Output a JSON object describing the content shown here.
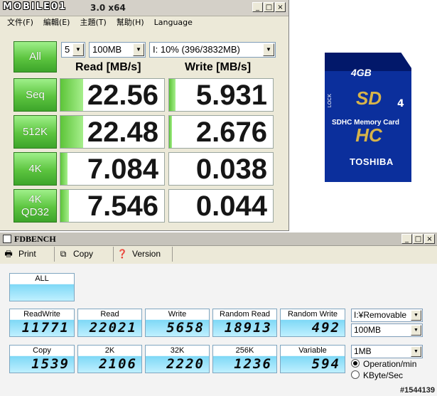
{
  "crystaldiskmark": {
    "title_logo": "MOBILE01",
    "title_version": "3.0 x64",
    "window_controls": [
      "_",
      "□",
      "×"
    ],
    "menu": [
      "文件(F)",
      "編輯(E)",
      "主題(T)",
      "幫助(H)",
      "Language"
    ],
    "all_label": "All",
    "runs": "5",
    "size": "100MB",
    "drive": "I: 10% (396/3832MB)",
    "read_header": "Read [MB/s]",
    "write_header": "Write [MB/s]",
    "rows": [
      {
        "label": "Seq",
        "read": "22.56",
        "write": "5.931",
        "read_fill": 0.22,
        "write_fill": 0.06
      },
      {
        "label": "512K",
        "read": "22.48",
        "write": "2.676",
        "read_fill": 0.22,
        "write_fill": 0.03
      },
      {
        "label": "4K",
        "read": "7.084",
        "write": "0.038",
        "read_fill": 0.07,
        "write_fill": 0.0
      },
      {
        "label_line1": "4K",
        "label_line2": "QD32",
        "read": "7.546",
        "write": "0.044",
        "read_fill": 0.08,
        "write_fill": 0.0
      }
    ],
    "accent_green": "#5cc43f"
  },
  "sd_card": {
    "capacity": "4GB",
    "logo": "SD HC",
    "class": "4",
    "lock": "LOCK",
    "subtitle": "SDHC Memory Card",
    "brand": "TOSHIBA",
    "color": "#0b2f9c"
  },
  "fdbench": {
    "title": "FDBENCH",
    "window_controls": [
      "_",
      "□",
      "×"
    ],
    "toolbar": {
      "print_label": "Print",
      "copy_label": "Copy",
      "version_label": "Version"
    },
    "all_label": "ALL",
    "row1": [
      {
        "label": "ReadWrite",
        "value": "11771"
      },
      {
        "label": "Read",
        "value": "22021"
      },
      {
        "label": "Write",
        "value": "5658"
      },
      {
        "label": "Random Read",
        "value": "18913"
      },
      {
        "label": "Random Write",
        "value": "492"
      }
    ],
    "row2": [
      {
        "label": "Copy",
        "value": "1539"
      },
      {
        "label": "2K",
        "value": "2106"
      },
      {
        "label": "32K",
        "value": "2220"
      },
      {
        "label": "256K",
        "value": "1236"
      },
      {
        "label": "Variable",
        "value": "594"
      }
    ],
    "drive_select": "I:¥Removable",
    "size_select": "100MB",
    "block_select": "1MB",
    "radio_operation": "Operation/min",
    "radio_kbyte": "KByte/Sec",
    "watermark": "#1544139",
    "lcd_color": "#7fd8f6"
  }
}
